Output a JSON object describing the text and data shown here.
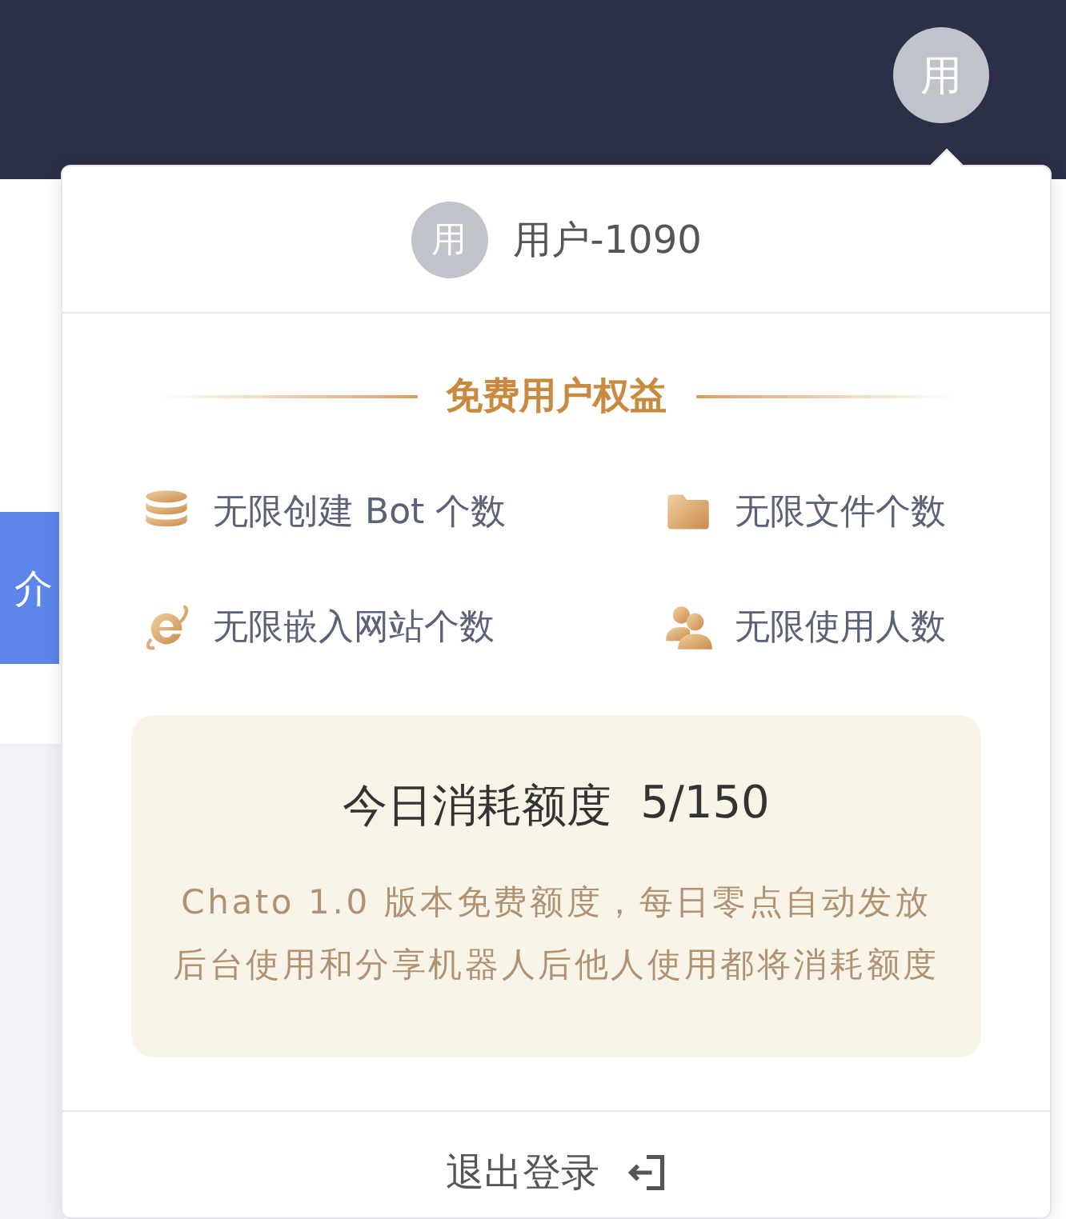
{
  "header": {
    "avatar": "用"
  },
  "sidebar": {
    "tab": "介"
  },
  "popover": {
    "user": {
      "avatar": "用",
      "name": "用户-1090"
    },
    "benefits_title": "免费用户权益",
    "benefits": [
      {
        "kind": "database",
        "label": "无限创建 Bot 个数"
      },
      {
        "kind": "folder",
        "label": "无限文件个数"
      },
      {
        "kind": "browser",
        "label": "无限嵌入网站个数"
      },
      {
        "kind": "users",
        "label": "无限使用人数"
      }
    ],
    "quota": {
      "title": "今日消耗额度",
      "value": "5/150",
      "notes": [
        "Chato 1.0 版本免费额度，每日零点自动发放",
        "后台使用和分享机器人后他人使用都将消耗额度"
      ]
    },
    "logout": "退出登录"
  }
}
